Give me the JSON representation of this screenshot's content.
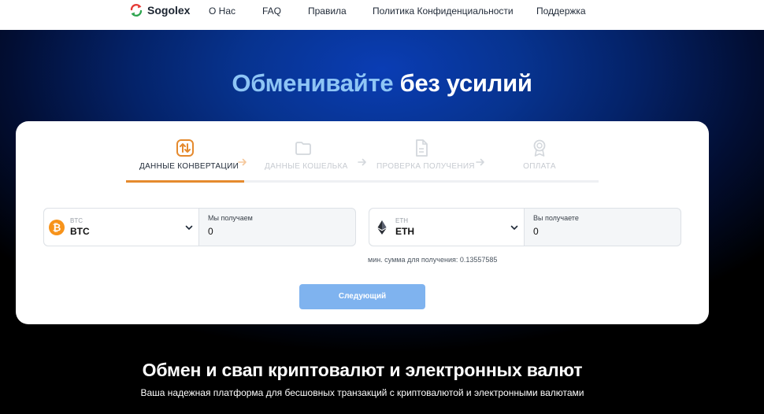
{
  "brand": {
    "name": "Sogolex",
    "logo_icon": "refresh-arrows-icon",
    "colors": [
      "#e53935",
      "#2ea44f"
    ]
  },
  "nav": {
    "items": [
      "О Нас",
      "FAQ",
      "Правила",
      "Политика Конфиденциальности",
      "Поддержка"
    ]
  },
  "hero": {
    "title_accent": "Обменивайте",
    "title_rest": " без усилий"
  },
  "steps": [
    {
      "label": "ДАННЫЕ КОНВЕРТАЦИИ",
      "icon": "swap-icon",
      "active": true
    },
    {
      "label": "ДАННЫЕ КОШЕЛЬКА",
      "icon": "wallet-icon",
      "active": false
    },
    {
      "label": "ПРОВЕРКА ПОЛУЧЕНИЯ",
      "icon": "document-icon",
      "active": false
    },
    {
      "label": "ОПЛАТА",
      "icon": "badge-icon",
      "active": false
    }
  ],
  "from": {
    "coin_small": "BTC",
    "coin_main": "BTC",
    "icon": "bitcoin-icon",
    "amount_label": "Мы получаем",
    "amount_value": "0"
  },
  "to": {
    "coin_small": "ETH",
    "coin_main": "ETH",
    "icon": "ethereum-icon",
    "amount_label": "Вы получаете",
    "amount_value": "0"
  },
  "min_sum": "мин. сумма для получения: 0.13557585",
  "next_button": "Следующий",
  "section": {
    "title": "Обмен и свап криптовалют и электронных валют",
    "description": "Ваша надежная платформа для бесшовных транзакций с криптовалютой и электронными валютами"
  },
  "accent_colors": {
    "step_active": "#e58a2e",
    "button": "#7fb3ef",
    "title_accent": "#8ec5f5",
    "bitcoin": "#f7931a"
  }
}
